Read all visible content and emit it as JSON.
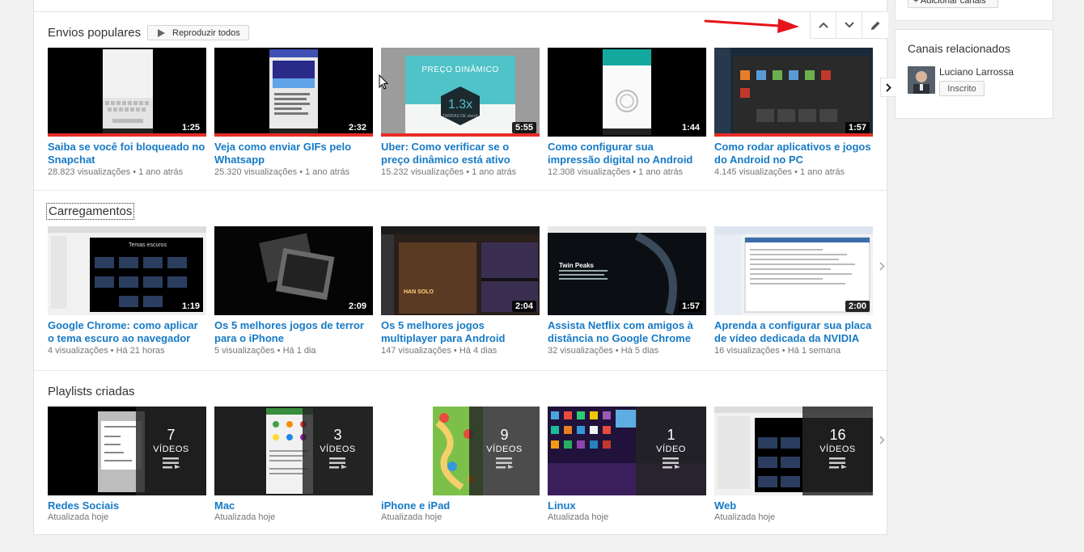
{
  "shelves": {
    "popular": {
      "title": "Envios populares",
      "play_all": "Reproduzir todos",
      "videos": [
        {
          "title": "Saiba se você foi bloqueado no Snapchat",
          "views": "28.823 visualizações",
          "age": "1 ano atrás",
          "duration": "1:25"
        },
        {
          "title": "Veja como enviar GIFs pelo Whatsapp",
          "views": "25.320 visualizações",
          "age": "1 ano atrás",
          "duration": "2:32"
        },
        {
          "title": "Uber: Como verificar se o preço dinâmico está ativo",
          "views": "15.232 visualizações",
          "age": "1 ano atrás",
          "duration": "5:55",
          "thumb_heading": "PREÇO DINÂMICO",
          "thumb_value": "1.3x",
          "thumb_caption": "TARIFAS DE uberX"
        },
        {
          "title": "Como configurar sua impressão digital no Android",
          "views": "12.308 visualizações",
          "age": "1 ano atrás",
          "duration": "1:44"
        },
        {
          "title": "Como rodar aplicativos e jogos do Android no PC",
          "views": "4.145 visualizações",
          "age": "1 ano atrás",
          "duration": "1:57"
        }
      ]
    },
    "uploads": {
      "title": "Carregamentos",
      "videos": [
        {
          "title": "Google Chrome: como aplicar o tema escuro ao navegador",
          "views": "4 visualizações",
          "age": "Há 21 horas",
          "duration": "1:19",
          "thumb_text": "Temas escuros"
        },
        {
          "title": "Os 5 melhores jogos de terror para o iPhone",
          "views": "5 visualizações",
          "age": "Há 1 dia",
          "duration": "2:09"
        },
        {
          "title": "Os 5 melhores jogos multiplayer para Android",
          "views": "147 visualizações",
          "age": "Há 4 dias",
          "duration": "2:04",
          "thumb_text": "HAN SOLO"
        },
        {
          "title": "Assista Netflix com amigos à distância no Google Chrome",
          "views": "32 visualizações",
          "age": "Há 5 dias",
          "duration": "1:57",
          "thumb_text": "Twin Peaks"
        },
        {
          "title": "Aprenda a configurar sua placa de vídeo dedicada da NVIDIA",
          "views": "16 visualizações",
          "age": "Há 1 semana",
          "duration": "2:00"
        }
      ]
    },
    "playlists": {
      "title": "Playlists criadas",
      "video_label": "VÍDEOS",
      "items": [
        {
          "title": "Redes Sociais",
          "meta": "Atualizada hoje",
          "count": "7"
        },
        {
          "title": "Mac",
          "meta": "Atualizada hoje",
          "count": "3"
        },
        {
          "title": "iPhone e iPad",
          "meta": "Atualizada hoje",
          "count": "9"
        },
        {
          "title": "Linux",
          "meta": "Atualizada hoje",
          "count": "1",
          "video_label": "VÍDEO"
        },
        {
          "title": "Web",
          "meta": "Atualizada hoje",
          "count": "16"
        }
      ]
    }
  },
  "sidebar": {
    "top_button": "+ Adicionar canais",
    "related_title": "Canais relacionados",
    "channel_name": "Luciano Larrossa",
    "subscribe_label": "Inscrito"
  },
  "meta_separator": "•",
  "icons": {
    "move_up": "chevron-up-icon",
    "move_down": "chevron-down-icon",
    "edit": "pencil-icon",
    "next": "chevron-right-icon"
  },
  "colors": {
    "link": "#167ac6",
    "annotation_arrow": "#e8141c",
    "watched_bar": "#e52d27"
  }
}
